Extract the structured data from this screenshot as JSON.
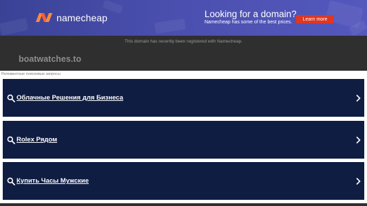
{
  "banner": {
    "brand": "namecheap",
    "headline": "Looking for a domain?",
    "subline": "Namecheap has some of the best prices.",
    "cta_label": "Learn more",
    "colors": {
      "accent": "#de3723",
      "banner": "#4a4fae",
      "result_bg": "#0f1d43"
    }
  },
  "notice": "This domain has recently been registered with Namecheap.",
  "domain": "boatwatches.to",
  "related_heading": "Релевантные поисковые запросы",
  "results": [
    {
      "label": "Облачные Решения для Бизнеса"
    },
    {
      "label": "Rolex Рядом"
    },
    {
      "label": "Купить Часы Мужские"
    }
  ]
}
